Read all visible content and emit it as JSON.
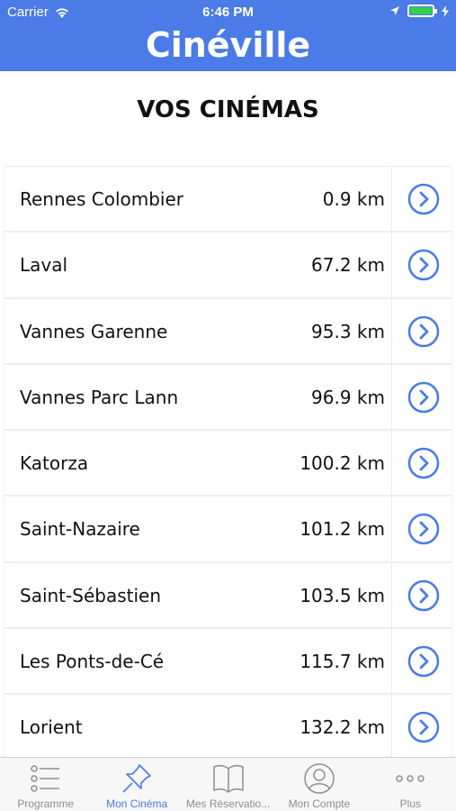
{
  "status_bar": {
    "carrier": "Carrier",
    "time": "6:46 PM"
  },
  "header": {
    "logo": "Cinéville"
  },
  "page": {
    "title": "VOS CINÉMAS"
  },
  "cinemas": [
    {
      "name": "Rennes Colombier",
      "distance": "0.9 km"
    },
    {
      "name": "Laval",
      "distance": "67.2 km"
    },
    {
      "name": "Vannes Garenne",
      "distance": "95.3 km"
    },
    {
      "name": "Vannes Parc Lann",
      "distance": "96.9 km"
    },
    {
      "name": "Katorza",
      "distance": "100.2 km"
    },
    {
      "name": "Saint-Nazaire",
      "distance": "101.2 km"
    },
    {
      "name": "Saint-Sébastien",
      "distance": "103.5 km"
    },
    {
      "name": "Les Ponts-de-Cé",
      "distance": "115.7 km"
    },
    {
      "name": "Lorient",
      "distance": "132.2 km"
    }
  ],
  "tabs": [
    {
      "label": "Programme",
      "icon": "list-icon",
      "active": false
    },
    {
      "label": "Mon Cinéma",
      "icon": "pin-icon",
      "active": true
    },
    {
      "label": "Mes Réservatio...",
      "icon": "book-icon",
      "active": false
    },
    {
      "label": "Mon Compte",
      "icon": "user-icon",
      "active": false
    },
    {
      "label": "Plus",
      "icon": "more-icon",
      "active": false
    }
  ],
  "colors": {
    "accent": "#4a7be6",
    "inactive": "#8e8e8e",
    "battery": "#35d14b"
  }
}
